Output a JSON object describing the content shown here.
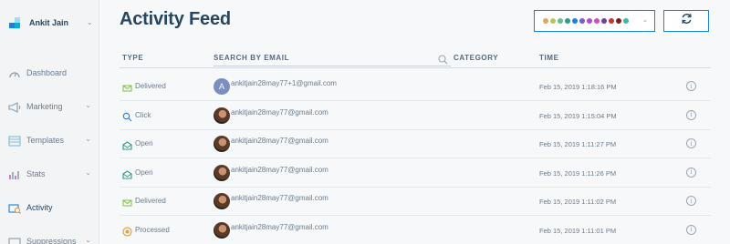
{
  "sidebar": {
    "user_name": "Ankit Jain",
    "items": [
      {
        "label": "Dashboard",
        "icon": "gauge-icon"
      },
      {
        "label": "Marketing",
        "icon": "megaphone-icon"
      },
      {
        "label": "Templates",
        "icon": "templates-icon"
      },
      {
        "label": "Stats",
        "icon": "chart-icon"
      },
      {
        "label": "Activity",
        "icon": "activity-icon"
      },
      {
        "label": "Suppressions",
        "icon": "suppressions-icon"
      }
    ]
  },
  "header": {
    "title": "Activity Feed",
    "filter_colors": [
      "#e8a25b",
      "#b6c85a",
      "#5fbf8e",
      "#2c9d8f",
      "#1a82e2",
      "#7b5bd6",
      "#a94fd1",
      "#d44fb6",
      "#6d3fa8",
      "#c0392b",
      "#7f1d1d",
      "#3fb8a6"
    ]
  },
  "table": {
    "columns": {
      "type": "TYPE",
      "search_placeholder": "SEARCH BY EMAIL",
      "category": "CATEGORY",
      "time": "TIME"
    },
    "rows": [
      {
        "type": "Delivered",
        "icon": "delivered-icon",
        "avatar": "A",
        "email": "ankitjain28may77+1@gmail.com",
        "time": "Feb 15, 2019 1:18:16 PM"
      },
      {
        "type": "Click",
        "icon": "click-icon",
        "avatar": "",
        "email": "ankitjain28may77@gmail.com",
        "time": "Feb 15, 2019 1:15:04 PM"
      },
      {
        "type": "Open",
        "icon": "open-icon",
        "avatar": "",
        "email": "ankitjain28may77@gmail.com",
        "time": "Feb 15, 2019 1:11:27 PM"
      },
      {
        "type": "Open",
        "icon": "open-icon",
        "avatar": "",
        "email": "ankitjain28may77@gmail.com",
        "time": "Feb 15, 2019 1:11:26 PM"
      },
      {
        "type": "Delivered",
        "icon": "delivered-icon",
        "avatar": "",
        "email": "ankitjain28may77@gmail.com",
        "time": "Feb 15, 2019 1:11:02 PM"
      },
      {
        "type": "Processed",
        "icon": "processed-icon",
        "avatar": "",
        "email": "ankitjain28may77@gmail.com",
        "time": "Feb 15, 2019 1:11:01 PM"
      }
    ]
  },
  "colors": {
    "accent": "#1a82e2",
    "title": "#294661"
  }
}
